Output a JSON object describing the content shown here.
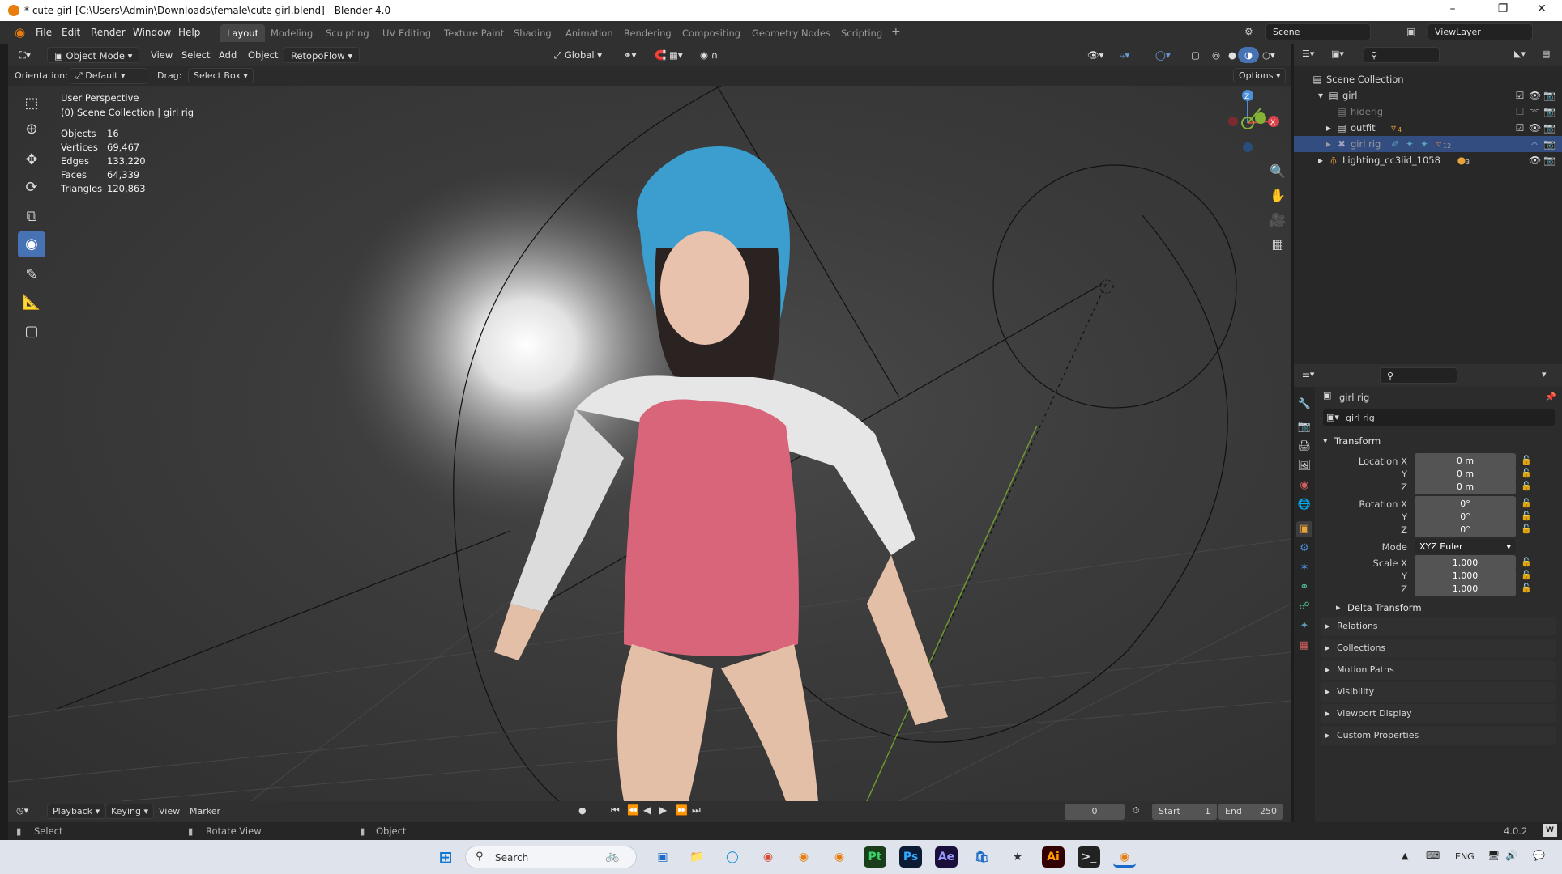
{
  "window": {
    "title": "* cute girl [C:\\Users\\Admin\\Downloads\\female\\cute girl.blend] - Blender 4.0"
  },
  "menu": [
    "File",
    "Edit",
    "Render",
    "Window",
    "Help"
  ],
  "workspaces": {
    "active": "Layout",
    "tabs": [
      "Layout",
      "Modeling",
      "Sculpting",
      "UV Editing",
      "Texture Paint",
      "Shading",
      "Animation",
      "Rendering",
      "Compositing",
      "Geometry Nodes",
      "Scripting"
    ]
  },
  "scene": {
    "name": "Scene",
    "view_layer": "ViewLayer"
  },
  "viewport_header": {
    "mode": "Object Mode",
    "view": "View",
    "select": "Select",
    "add": "Add",
    "object": "Object",
    "addon": "RetopoFlow",
    "transform_orientation": "Global"
  },
  "tool_settings": {
    "orientation_label": "Orientation:",
    "orientation_value": "Default",
    "drag_label": "Drag:",
    "drag_value": "Select Box",
    "options": "Options"
  },
  "viewport": {
    "perspective": "User Perspective",
    "collection": "(0) Scene Collection | girl rig",
    "stats": [
      {
        "label": "Objects",
        "value": "16"
      },
      {
        "label": "Vertices",
        "value": "69,467"
      },
      {
        "label": "Edges",
        "value": "133,220"
      },
      {
        "label": "Faces",
        "value": "64,339"
      },
      {
        "label": "Triangles",
        "value": "120,863"
      }
    ],
    "gizmo": {
      "z": "Z",
      "x": "X"
    }
  },
  "outliner": {
    "root": "Scene Collection",
    "items": [
      {
        "label": "girl"
      },
      {
        "label": "hiderig"
      },
      {
        "label": "outfit",
        "badge": "4"
      },
      {
        "label": "girl rig",
        "badge": "12"
      },
      {
        "label": "Lighting_cc3iid_1058",
        "badge": "3"
      }
    ]
  },
  "properties": {
    "object_name": "girl rig",
    "data_name": "girl rig",
    "transform_title": "Transform",
    "location": {
      "label_x": "Location X",
      "x": "0 m",
      "y": "0 m",
      "z": "0 m"
    },
    "rotation": {
      "label_x": "Rotation X",
      "x": "0°",
      "y": "0°",
      "z": "0°"
    },
    "mode": {
      "label": "Mode",
      "value": "XYZ Euler"
    },
    "scale": {
      "label_x": "Scale X",
      "x": "1.000",
      "y": "1.000",
      "z": "1.000"
    },
    "axis_labels": {
      "y": "Y",
      "z": "Z"
    },
    "delta_transform": "Delta Transform",
    "panels": [
      "Relations",
      "Collections",
      "Motion Paths",
      "Visibility",
      "Viewport Display",
      "Custom Properties"
    ]
  },
  "timeline": {
    "playback": "Playback",
    "keying": "Keying",
    "view": "View",
    "marker": "Marker",
    "current_frame": "0",
    "start_label": "Start",
    "start": "1",
    "end_label": "End",
    "end": "250"
  },
  "statusbar": {
    "select": "Select",
    "rotate_view": "Rotate View",
    "object": "Object",
    "version": "4.0.2"
  },
  "taskbar": {
    "search_placeholder": "Search",
    "lang": "ENG"
  }
}
